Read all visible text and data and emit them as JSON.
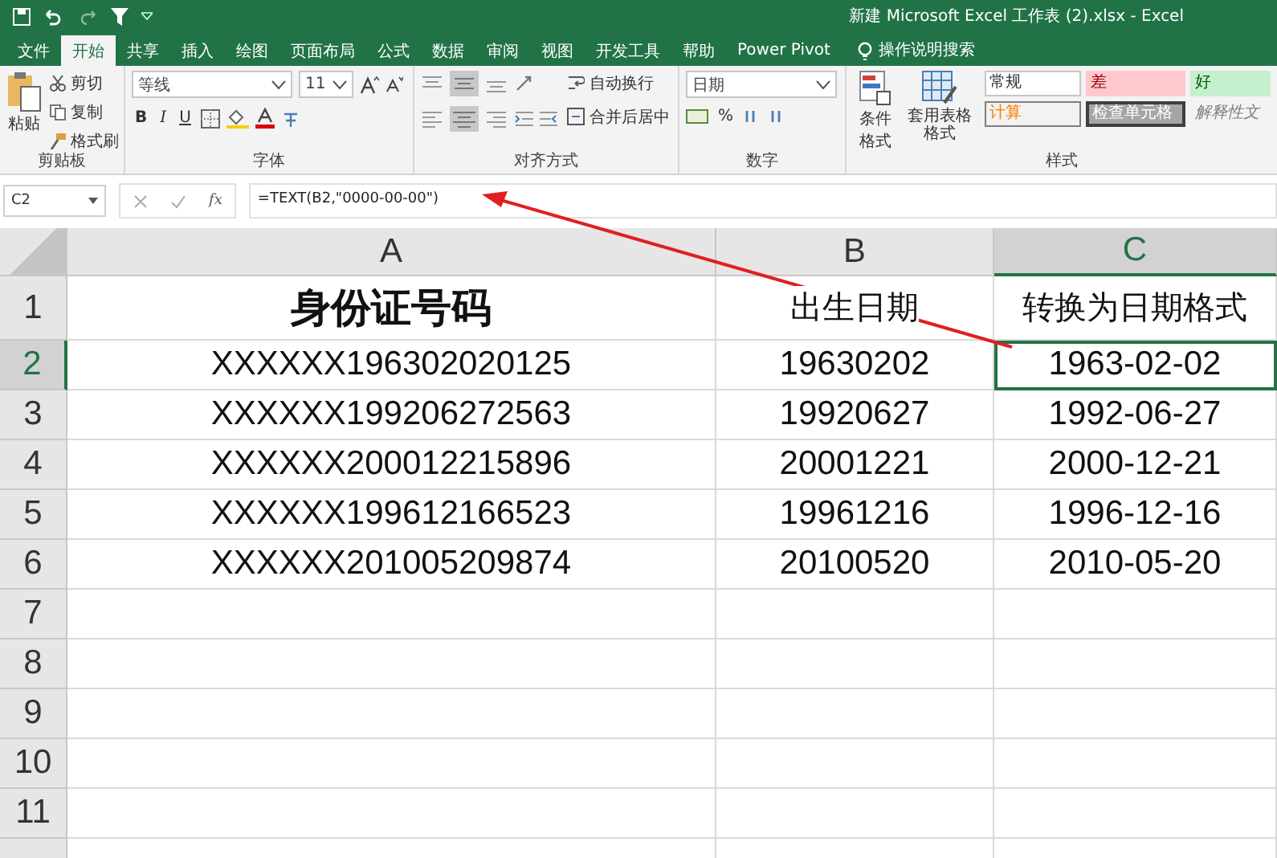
{
  "window": {
    "title": "新建 Microsoft Excel 工作表 (2).xlsx  -  Excel"
  },
  "tabs": [
    {
      "label": "文件",
      "selected": false
    },
    {
      "label": "开始",
      "selected": true
    },
    {
      "label": "共享",
      "selected": false
    },
    {
      "label": "插入",
      "selected": false
    },
    {
      "label": "绘图",
      "selected": false
    },
    {
      "label": "页面布局",
      "selected": false
    },
    {
      "label": "公式",
      "selected": false
    },
    {
      "label": "数据",
      "selected": false
    },
    {
      "label": "审阅",
      "selected": false
    },
    {
      "label": "视图",
      "selected": false
    },
    {
      "label": "开发工具",
      "selected": false
    },
    {
      "label": "帮助",
      "selected": false
    },
    {
      "label": "Power Pivot",
      "selected": false
    }
  ],
  "tell_me": {
    "placeholder": "操作说明搜索"
  },
  "ribbon": {
    "clipboard": {
      "paste": "粘贴",
      "cut": "剪切",
      "copy": "复制",
      "format_painter": "格式刷",
      "label": "剪贴板"
    },
    "font": {
      "font_name": "等线",
      "font_size": "11",
      "bold": "B",
      "italic": "I",
      "underline": "U",
      "label": "字体"
    },
    "alignment": {
      "wrap_text": "自动换行",
      "merge_center": "合并后居中",
      "label": "对齐方式"
    },
    "number": {
      "format": "日期",
      "percent": "%",
      "label": "数字"
    },
    "styles": {
      "conditional_formatting": "条件格式",
      "format_as_table": "套用表格格式",
      "label": "样式",
      "cell_styles": [
        {
          "label": "常规",
          "kind": "normal"
        },
        {
          "label": "差",
          "kind": "bad"
        },
        {
          "label": "好",
          "kind": "good"
        },
        {
          "label": "计算",
          "kind": "calc"
        },
        {
          "label": "检查单元格",
          "kind": "check"
        },
        {
          "label": "解释性文",
          "kind": "note"
        }
      ]
    }
  },
  "formula_bar": {
    "name_box": "C2",
    "fx": "fx",
    "formula": "=TEXT(B2,\"0000-00-00\")"
  },
  "sheet": {
    "columns": [
      {
        "label": "A",
        "selected": false
      },
      {
        "label": "B",
        "selected": false
      },
      {
        "label": "C",
        "selected": true
      }
    ],
    "rows": [
      {
        "number": "1",
        "selected": false,
        "cells": [
          {
            "text": "身份证号码",
            "bold": true,
            "selected": false
          },
          {
            "text": "出生日期",
            "bold": false,
            "selected": false
          },
          {
            "text": "转换为日期格式",
            "bold": false,
            "selected": false
          }
        ]
      },
      {
        "number": "2",
        "selected": true,
        "cells": [
          {
            "text": "XXXXXX196302020125",
            "bold": false,
            "selected": false
          },
          {
            "text": "19630202",
            "bold": false,
            "selected": false
          },
          {
            "text": "1963-02-02",
            "bold": false,
            "selected": true
          }
        ]
      },
      {
        "number": "3",
        "selected": false,
        "cells": [
          {
            "text": "XXXXXX199206272563",
            "bold": false,
            "selected": false
          },
          {
            "text": "19920627",
            "bold": false,
            "selected": false
          },
          {
            "text": "1992-06-27",
            "bold": false,
            "selected": false
          }
        ]
      },
      {
        "number": "4",
        "selected": false,
        "cells": [
          {
            "text": "XXXXXX200012215896",
            "bold": false,
            "selected": false
          },
          {
            "text": "20001221",
            "bold": false,
            "selected": false
          },
          {
            "text": "2000-12-21",
            "bold": false,
            "selected": false
          }
        ]
      },
      {
        "number": "5",
        "selected": false,
        "cells": [
          {
            "text": "XXXXXX199612166523",
            "bold": false,
            "selected": false
          },
          {
            "text": "19961216",
            "bold": false,
            "selected": false
          },
          {
            "text": "1996-12-16",
            "bold": false,
            "selected": false
          }
        ]
      },
      {
        "number": "6",
        "selected": false,
        "cells": [
          {
            "text": "XXXXXX201005209874",
            "bold": false,
            "selected": false
          },
          {
            "text": "20100520",
            "bold": false,
            "selected": false
          },
          {
            "text": "2010-05-20",
            "bold": false,
            "selected": false
          }
        ]
      },
      {
        "number": "7",
        "selected": false,
        "cells": []
      },
      {
        "number": "8",
        "selected": false,
        "cells": []
      },
      {
        "number": "9",
        "selected": false,
        "cells": []
      },
      {
        "number": "10",
        "selected": false,
        "cells": []
      },
      {
        "number": "11",
        "selected": false,
        "cells": []
      }
    ]
  }
}
